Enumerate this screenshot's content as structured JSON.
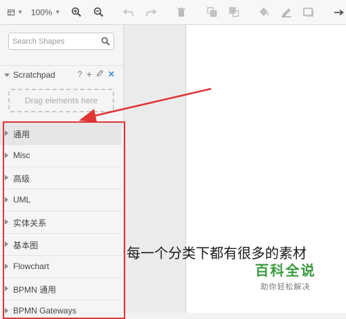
{
  "toolbar": {
    "zoom": "100%"
  },
  "sidebar": {
    "search_placeholder": "Search Shapes",
    "scratchpad": {
      "title": "Scratchpad",
      "help": "?",
      "add": "+",
      "close": "✕",
      "drop_hint": "Drag elements here"
    },
    "palettes": [
      "通用",
      "Misc",
      "高级",
      "UML",
      "实体关系",
      "基本图",
      "Flowchart",
      "BPMN 通用",
      "BPMN Gateways"
    ]
  },
  "annotation": {
    "text": "每一个分类下都有很多的素材"
  },
  "watermark": {
    "title": "百科全说",
    "subtitle": "助你轻松解决"
  },
  "colors": {
    "highlight": "#e03535",
    "watermark": "#3a9a3f"
  }
}
